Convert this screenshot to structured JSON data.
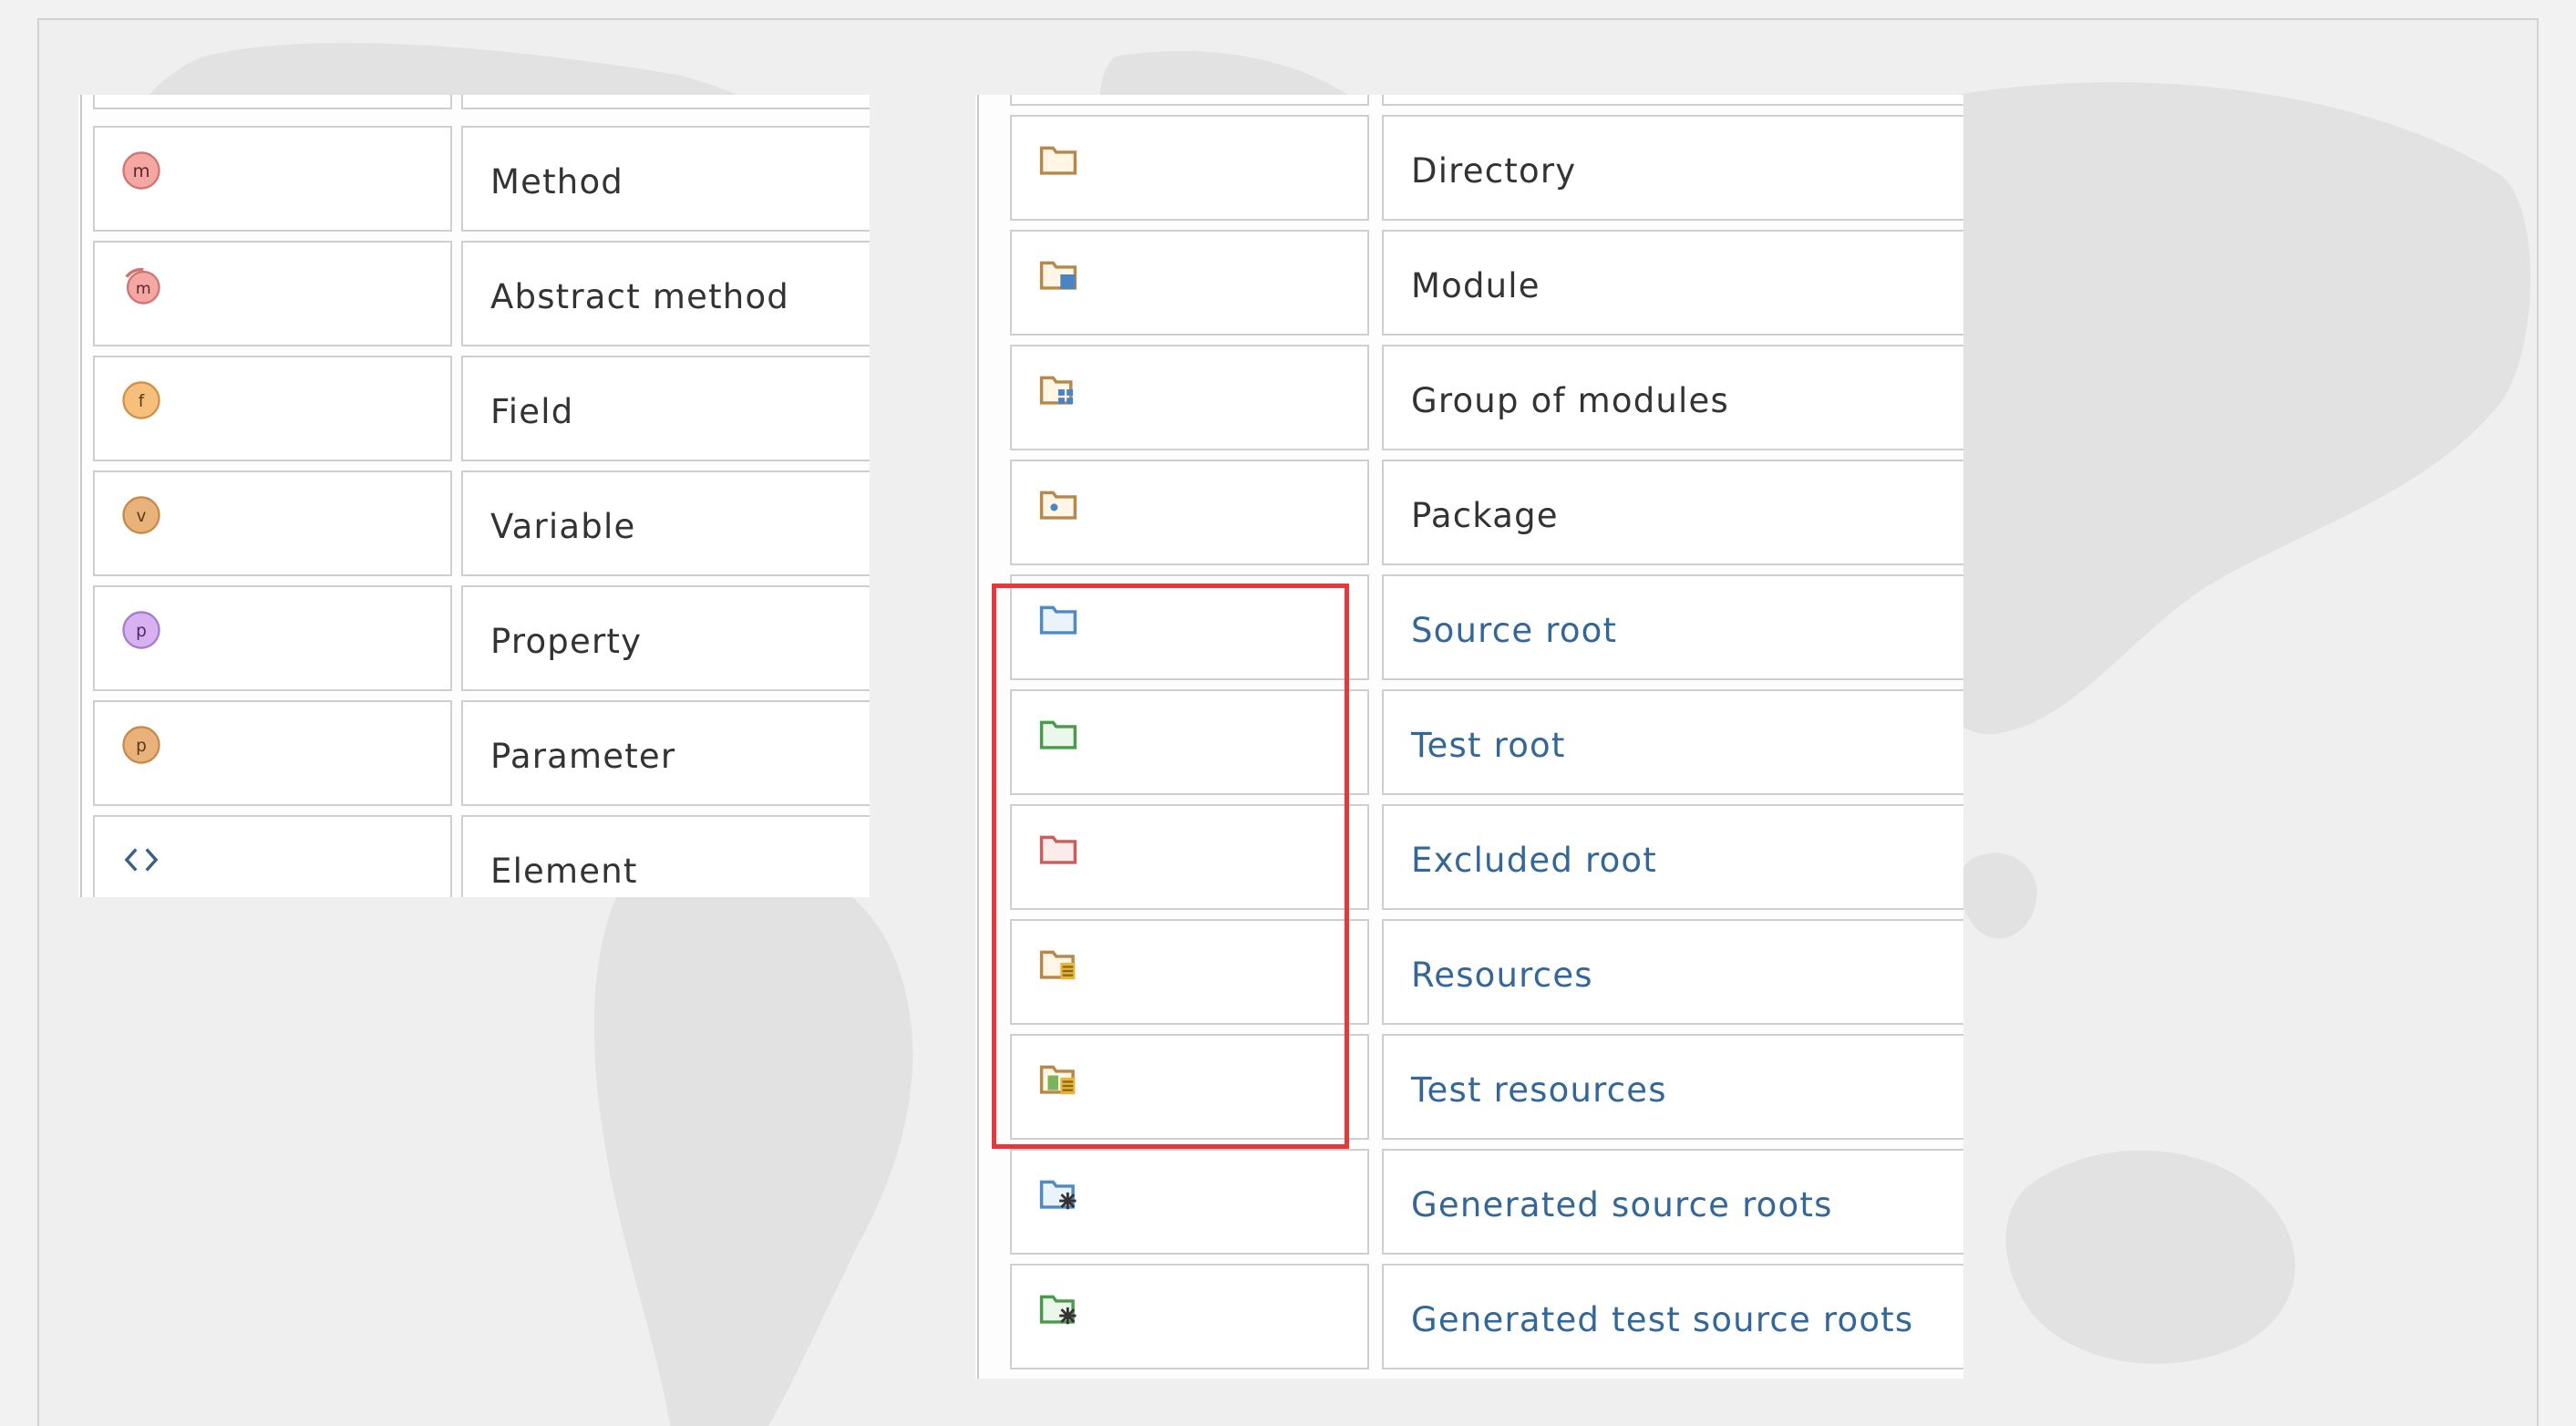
{
  "left_table": {
    "rows": [
      {
        "icon": "method-icon",
        "label": "Method"
      },
      {
        "icon": "abstract-method-icon",
        "label": "Abstract method"
      },
      {
        "icon": "field-icon",
        "label": "Field"
      },
      {
        "icon": "variable-icon",
        "label": "Variable"
      },
      {
        "icon": "property-icon",
        "label": "Property"
      },
      {
        "icon": "parameter-icon",
        "label": "Parameter"
      },
      {
        "icon": "element-icon",
        "label": "Element"
      }
    ]
  },
  "right_table": {
    "rows": [
      {
        "icon": "directory-icon",
        "label": "Directory",
        "link": false
      },
      {
        "icon": "module-icon",
        "label": "Module",
        "link": false
      },
      {
        "icon": "group-of-modules-icon",
        "label": "Group of modules",
        "link": false
      },
      {
        "icon": "package-icon",
        "label": "Package",
        "link": false
      },
      {
        "icon": "source-root-icon",
        "label": "Source root",
        "link": true
      },
      {
        "icon": "test-root-icon",
        "label": "Test root",
        "link": true
      },
      {
        "icon": "excluded-root-icon",
        "label": "Excluded root",
        "link": true
      },
      {
        "icon": "resources-icon",
        "label": "Resources",
        "link": true
      },
      {
        "icon": "test-resources-icon",
        "label": "Test resources",
        "link": true
      },
      {
        "icon": "generated-source-roots-icon",
        "label": "Generated source roots",
        "link": true
      },
      {
        "icon": "generated-test-source-roots-icon",
        "label": "Generated test source roots",
        "link": true
      }
    ]
  },
  "colors": {
    "highlight": "#e3393d",
    "link_text": "#336699",
    "plain_text": "#333333"
  }
}
